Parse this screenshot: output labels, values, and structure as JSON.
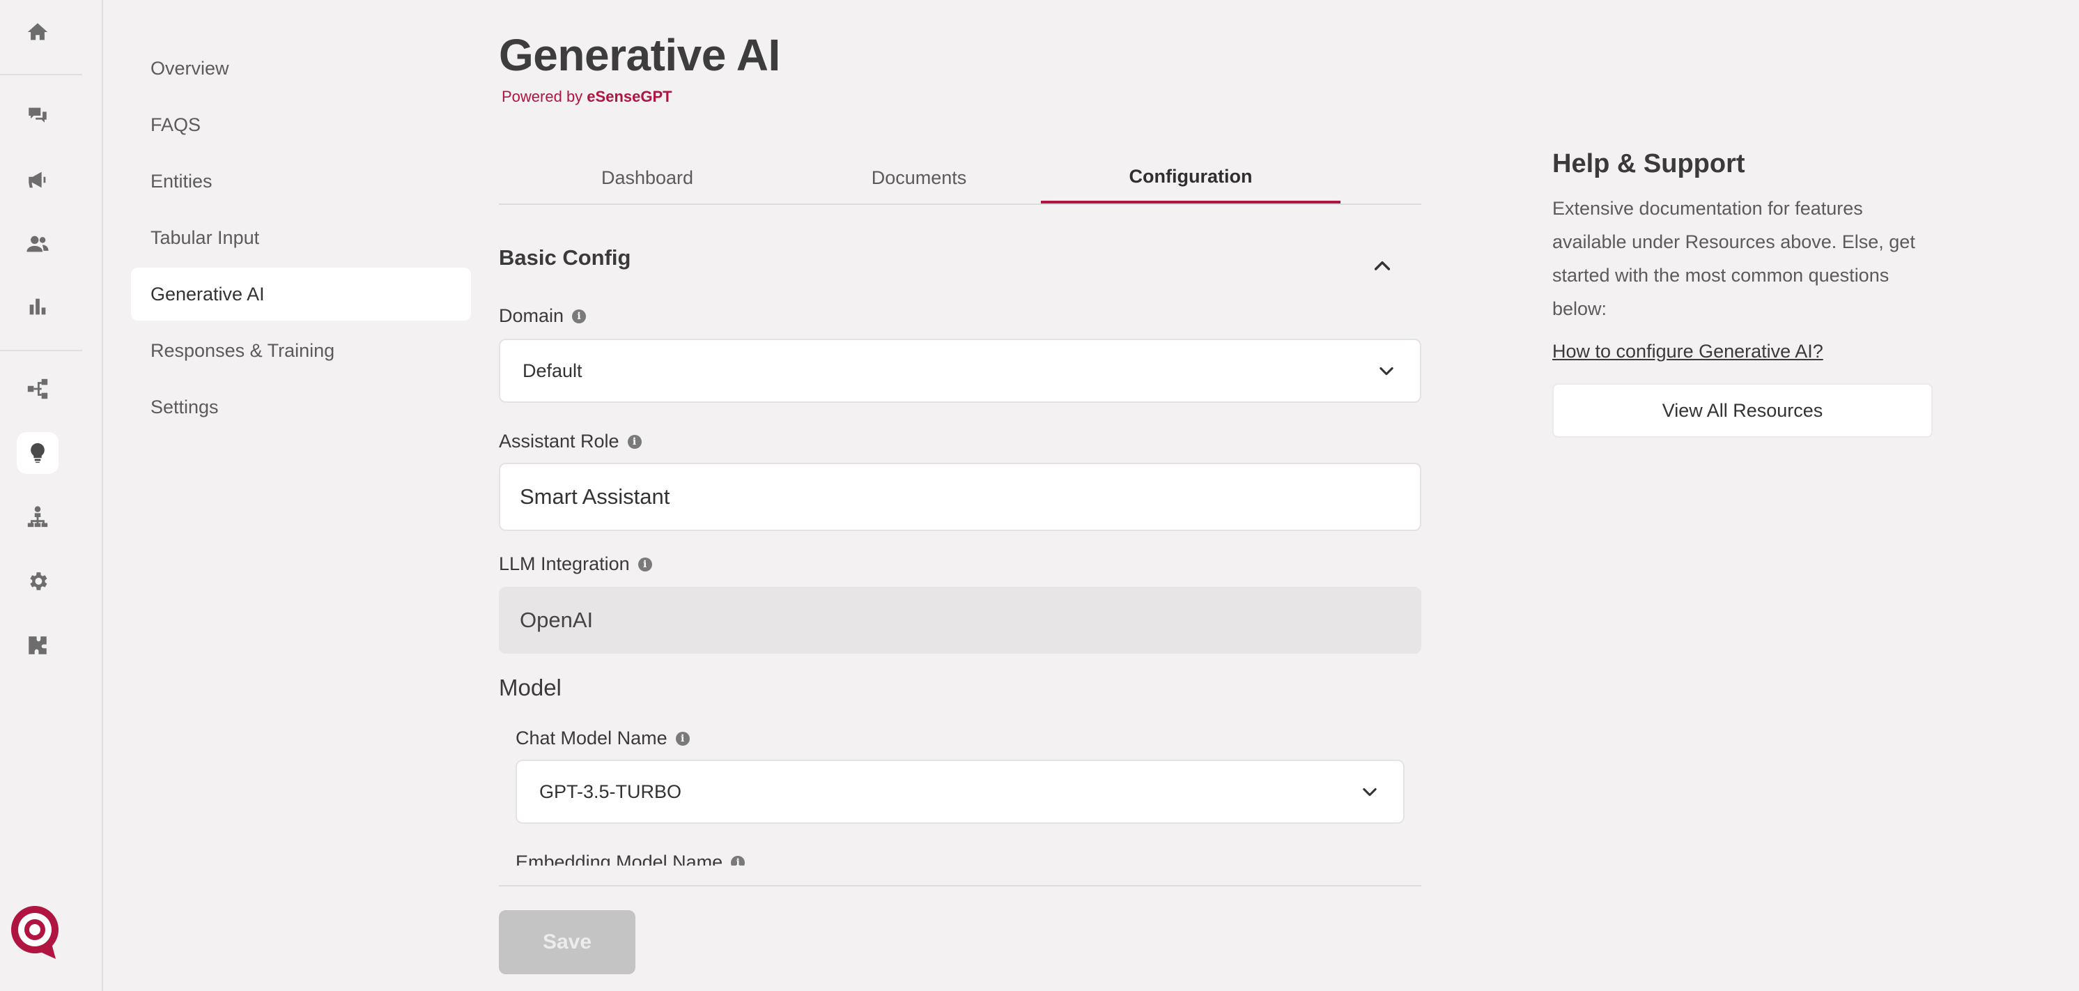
{
  "rail": {
    "icons": [
      "home-icon",
      "chat-icon",
      "megaphone-icon",
      "users-icon",
      "bar-chart-icon",
      "flow-icon",
      "lightbulb-icon",
      "hierarchy-icon",
      "gear-icon",
      "puzzle-icon"
    ],
    "active": "lightbulb-icon"
  },
  "subnav": {
    "items": [
      {
        "label": "Overview"
      },
      {
        "label": "FAQS"
      },
      {
        "label": "Entities"
      },
      {
        "label": "Tabular Input"
      },
      {
        "label": "Generative AI"
      },
      {
        "label": "Responses & Training"
      },
      {
        "label": "Settings"
      }
    ],
    "active_index": 4
  },
  "header": {
    "title": "Generative AI",
    "powered_prefix": "Powered by ",
    "powered_brand": "eSenseGPT"
  },
  "tabs": [
    {
      "label": "Dashboard"
    },
    {
      "label": "Documents"
    },
    {
      "label": "Configuration"
    }
  ],
  "basic_config": {
    "title": "Basic Config",
    "domain": {
      "label": "Domain",
      "value": "Default"
    },
    "assistant_role": {
      "label": "Assistant Role",
      "value": "Smart Assistant"
    },
    "llm_integration": {
      "label": "LLM Integration",
      "value": "OpenAI"
    },
    "model": {
      "title": "Model",
      "chat_model": {
        "label": "Chat Model Name",
        "value": "GPT-3.5-TURBO"
      },
      "embedding_model": {
        "label": "Embedding Model Name"
      }
    }
  },
  "actions": {
    "save_label": "Save"
  },
  "help": {
    "title": "Help & Support",
    "text": "Extensive documentation for features available under Resources above. Else, get started with the most common questions below:",
    "link": "How to configure Generative AI?",
    "button": "View All Resources"
  },
  "colors": {
    "accent": "#b01440",
    "background": "#f3f1f2"
  }
}
